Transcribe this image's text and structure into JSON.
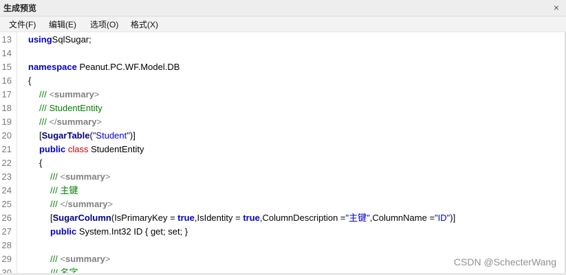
{
  "window": {
    "title": "生成预览",
    "close_glyph": "×"
  },
  "menu": [
    {
      "label": "文件(F)"
    },
    {
      "label": "编辑(E)"
    },
    {
      "label": "选项(O)"
    },
    {
      "label": "格式(X)"
    }
  ],
  "lines": [
    {
      "n": "13",
      "ind": 0,
      "t": [
        [
          "kw",
          "using"
        ],
        [
          "",
          "SqlSugar;"
        ]
      ]
    },
    {
      "n": "14",
      "ind": 0,
      "t": []
    },
    {
      "n": "15",
      "ind": 0,
      "t": [
        [
          "kw",
          "namespace"
        ],
        [
          "",
          " Peanut.PC.WF.Model.DB"
        ]
      ]
    },
    {
      "n": "16",
      "ind": 0,
      "t": [
        [
          "",
          "{"
        ]
      ]
    },
    {
      "n": "17",
      "ind": 1,
      "t": [
        [
          "cm",
          "/// "
        ],
        [
          "xml",
          "<"
        ],
        [
          "xmlb",
          "summary"
        ],
        [
          "xml",
          ">"
        ]
      ]
    },
    {
      "n": "18",
      "ind": 1,
      "t": [
        [
          "cm",
          "/// StudentEntity"
        ]
      ]
    },
    {
      "n": "19",
      "ind": 1,
      "t": [
        [
          "cm",
          "/// "
        ],
        [
          "xml",
          "</"
        ],
        [
          "xmlb",
          "summary"
        ],
        [
          "xml",
          ">"
        ]
      ]
    },
    {
      "n": "20",
      "ind": 1,
      "t": [
        [
          "",
          "["
        ],
        [
          "attrb",
          "SugarTable"
        ],
        [
          "",
          "("
        ],
        [
          "str",
          "\"Student\""
        ],
        [
          "",
          ")]"
        ]
      ]
    },
    {
      "n": "21",
      "ind": 1,
      "t": [
        [
          "kw",
          "public"
        ],
        [
          "kwred",
          " class"
        ],
        [
          "",
          " StudentEntity"
        ]
      ]
    },
    {
      "n": "22",
      "ind": 1,
      "t": [
        [
          "",
          "{"
        ]
      ]
    },
    {
      "n": "23",
      "ind": 2,
      "t": [
        [
          "cm",
          "/// "
        ],
        [
          "xml",
          "<"
        ],
        [
          "xmlb",
          "summary"
        ],
        [
          "xml",
          ">"
        ]
      ]
    },
    {
      "n": "24",
      "ind": 2,
      "t": [
        [
          "cm",
          "/// 主键"
        ]
      ]
    },
    {
      "n": "25",
      "ind": 2,
      "t": [
        [
          "cm",
          "/// "
        ],
        [
          "xml",
          "</"
        ],
        [
          "xmlb",
          "summary"
        ],
        [
          "xml",
          ">"
        ]
      ]
    },
    {
      "n": "26",
      "ind": 2,
      "t": [
        [
          "",
          "["
        ],
        [
          "attrb",
          "SugarColumn"
        ],
        [
          "",
          "(IsPrimaryKey = "
        ],
        [
          "kw",
          "true"
        ],
        [
          "",
          ",IsIdentity = "
        ],
        [
          "kw",
          "true"
        ],
        [
          "",
          ",ColumnDescription ="
        ],
        [
          "str",
          "\"主键\""
        ],
        [
          "",
          ",ColumnName ="
        ],
        [
          "str",
          "\"ID\""
        ],
        [
          "",
          ")]"
        ]
      ]
    },
    {
      "n": "27",
      "ind": 2,
      "t": [
        [
          "kw",
          "public"
        ],
        [
          "",
          " System.Int32 ID { get; set; }"
        ]
      ]
    },
    {
      "n": "28",
      "ind": 0,
      "t": []
    },
    {
      "n": "29",
      "ind": 2,
      "t": [
        [
          "cm",
          "/// "
        ],
        [
          "xml",
          "<"
        ],
        [
          "xmlb",
          "summary"
        ],
        [
          "xml",
          ">"
        ]
      ]
    },
    {
      "n": "30",
      "ind": 2,
      "t": [
        [
          "cm",
          "/// 名字"
        ]
      ]
    }
  ],
  "watermark": "CSDN @SchecterWang",
  "colors": {
    "keyword": "#0000cd",
    "class_keyword": "#c80000",
    "comment": "#008000",
    "xml_tag": "#808080",
    "string": "#0000cd",
    "attribute": "#000080"
  },
  "icons": [
    "close-icon"
  ]
}
